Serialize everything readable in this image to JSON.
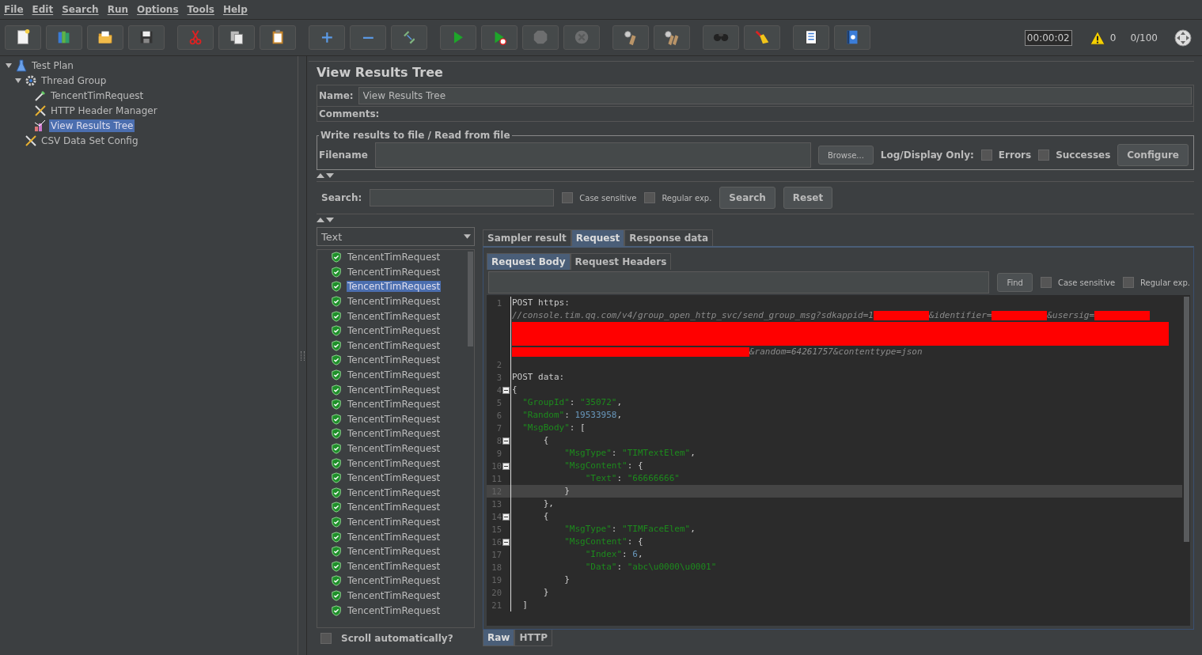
{
  "menu": [
    "File",
    "Edit",
    "Search",
    "Run",
    "Options",
    "Tools",
    "Help"
  ],
  "toolbar": [
    [
      {
        "kind": "new",
        "disabled": false
      },
      {
        "kind": "templates",
        "disabled": false
      },
      {
        "kind": "open",
        "disabled": false
      },
      {
        "kind": "save",
        "disabled": false
      }
    ],
    [
      {
        "kind": "cut",
        "disabled": false
      },
      {
        "kind": "copy",
        "disabled": false
      },
      {
        "kind": "paste",
        "disabled": false
      }
    ],
    [
      {
        "kind": "expand",
        "disabled": false
      },
      {
        "kind": "collapse",
        "disabled": false
      },
      {
        "kind": "toggle",
        "disabled": false
      }
    ],
    [
      {
        "kind": "start",
        "disabled": false
      },
      {
        "kind": "start_no_pause",
        "disabled": false
      },
      {
        "kind": "stop",
        "disabled": true
      },
      {
        "kind": "shutdown",
        "disabled": true
      }
    ],
    [
      {
        "kind": "clear",
        "disabled": false
      },
      {
        "kind": "clear_all",
        "disabled": false
      }
    ],
    [
      {
        "kind": "search",
        "disabled": false
      },
      {
        "kind": "reset_search",
        "disabled": false
      }
    ],
    [
      {
        "kind": "functions",
        "disabled": false
      },
      {
        "kind": "help",
        "disabled": false
      }
    ]
  ],
  "status": {
    "timer": "00:00:02",
    "warnings": "0",
    "threads": "0/100"
  },
  "tree": [
    {
      "label": "Test Plan",
      "kind": "plan",
      "expanded": true,
      "selected": false,
      "children": [
        {
          "label": "Thread Group",
          "kind": "threads",
          "expanded": true,
          "selected": false,
          "children": [
            {
              "label": "TencentTimRequest",
              "kind": "sampler",
              "selected": false
            },
            {
              "label": "HTTP Header Manager",
              "kind": "config",
              "selected": false
            },
            {
              "label": "View Results Tree",
              "kind": "listener",
              "selected": true
            }
          ]
        },
        {
          "label": "CSV Data Set Config",
          "kind": "config",
          "selected": false
        }
      ]
    }
  ],
  "panel": {
    "title": "View Results Tree",
    "name_label": "Name:",
    "name_value": "View Results Tree",
    "comments_label": "Comments:",
    "file_group": {
      "legend": "Write results to file / Read from file",
      "filename_label": "Filename",
      "browse": "Browse...",
      "log_label": "Log/Display Only:",
      "checks": [
        {
          "label": "Errors",
          "checked": false
        },
        {
          "label": "Successes",
          "checked": false
        }
      ],
      "configure": "Configure"
    },
    "search": {
      "label": "Search:",
      "options": [
        {
          "label": "Case sensitive",
          "checked": false
        },
        {
          "label": "Regular exp.",
          "checked": false
        }
      ],
      "buttons": [
        "Search",
        "Reset"
      ]
    },
    "renderer": "Text",
    "results": [
      {
        "label": "TencentTimRequest",
        "selected": false
      },
      {
        "label": "TencentTimRequest",
        "selected": false
      },
      {
        "label": "TencentTimRequest",
        "selected": true
      },
      {
        "label": "TencentTimRequest",
        "selected": false
      },
      {
        "label": "TencentTimRequest",
        "selected": false
      },
      {
        "label": "TencentTimRequest",
        "selected": false
      },
      {
        "label": "TencentTimRequest",
        "selected": false
      },
      {
        "label": "TencentTimRequest",
        "selected": false
      },
      {
        "label": "TencentTimRequest",
        "selected": false
      },
      {
        "label": "TencentTimRequest",
        "selected": false
      },
      {
        "label": "TencentTimRequest",
        "selected": false
      },
      {
        "label": "TencentTimRequest",
        "selected": false
      },
      {
        "label": "TencentTimRequest",
        "selected": false
      },
      {
        "label": "TencentTimRequest",
        "selected": false
      },
      {
        "label": "TencentTimRequest",
        "selected": false
      },
      {
        "label": "TencentTimRequest",
        "selected": false
      },
      {
        "label": "TencentTimRequest",
        "selected": false
      },
      {
        "label": "TencentTimRequest",
        "selected": false
      },
      {
        "label": "TencentTimRequest",
        "selected": false
      },
      {
        "label": "TencentTimRequest",
        "selected": false
      },
      {
        "label": "TencentTimRequest",
        "selected": false
      },
      {
        "label": "TencentTimRequest",
        "selected": false
      },
      {
        "label": "TencentTimRequest",
        "selected": false
      },
      {
        "label": "TencentTimRequest",
        "selected": false
      },
      {
        "label": "TencentTimRequest",
        "selected": false
      }
    ],
    "scroll_auto": {
      "label": "Scroll automatically?",
      "checked": false
    },
    "tabs": [
      {
        "label": "Sampler result",
        "selected": false
      },
      {
        "label": "Request",
        "selected": true
      },
      {
        "label": "Response data",
        "selected": false
      }
    ],
    "sub_tabs": [
      {
        "label": "Request Body",
        "selected": true
      },
      {
        "label": "Request Headers",
        "selected": false
      }
    ],
    "find": {
      "button": "Find",
      "options": [
        {
          "label": "Case sensitive",
          "checked": false
        },
        {
          "label": "Regular exp.",
          "checked": false
        }
      ]
    },
    "code_lines": [
      {
        "number": "1",
        "fold": false,
        "current": false,
        "tokens": [
          {
            "kind": "plain",
            "text": "POST https:"
          },
          {
            "kind": "break"
          },
          {
            "kind": "url",
            "text": "//console.tim.qq.com/v4/group_open_http_svc/send_group_msg?sdkappid=1"
          },
          {
            "kind": "redacted_short"
          },
          {
            "kind": "url",
            "text": "&identifier="
          },
          {
            "kind": "redacted_short"
          },
          {
            "kind": "url",
            "text": "&usersig="
          },
          {
            "kind": "redacted_short"
          },
          {
            "kind": "break"
          },
          {
            "kind": "redacted_full"
          },
          {
            "kind": "break"
          },
          {
            "kind": "redacted_long"
          },
          {
            "kind": "url",
            "text": "&random=64261757&contenttype=json"
          }
        ]
      },
      {
        "number": "2",
        "fold": false,
        "current": false
      },
      {
        "number": "3",
        "fold": false,
        "current": false,
        "tokens": [
          {
            "kind": "plain",
            "text": "POST data:"
          }
        ]
      },
      {
        "number": "4",
        "fold": true,
        "current": false,
        "tokens": [
          {
            "kind": "plain",
            "text": "{"
          }
        ]
      },
      {
        "number": "5",
        "fold": false,
        "current": false,
        "tokens": [
          {
            "kind": "key",
            "text": "  \"GroupId\""
          },
          {
            "kind": "plain",
            "text": ": "
          },
          {
            "kind": "string",
            "text": "\"35072\""
          },
          {
            "kind": "plain",
            "text": ","
          }
        ]
      },
      {
        "number": "6",
        "fold": false,
        "current": false,
        "tokens": [
          {
            "kind": "key",
            "text": "  \"Random\""
          },
          {
            "kind": "plain",
            "text": ": "
          },
          {
            "kind": "number",
            "text": "19533958"
          },
          {
            "kind": "plain",
            "text": ","
          }
        ]
      },
      {
        "number": "7",
        "fold": false,
        "current": false,
        "tokens": [
          {
            "kind": "key",
            "text": "  \"MsgBody\""
          },
          {
            "kind": "plain",
            "text": ": ["
          }
        ]
      },
      {
        "number": "8",
        "fold": true,
        "current": false,
        "tokens": [
          {
            "kind": "plain",
            "text": "      {"
          }
        ]
      },
      {
        "number": "9",
        "fold": false,
        "current": false,
        "tokens": [
          {
            "kind": "key",
            "text": "          \"MsgType\""
          },
          {
            "kind": "plain",
            "text": ": "
          },
          {
            "kind": "string",
            "text": "\"TIMTextElem\""
          },
          {
            "kind": "plain",
            "text": ","
          }
        ]
      },
      {
        "number": "10",
        "fold": true,
        "current": false,
        "tokens": [
          {
            "kind": "key",
            "text": "          \"MsgContent\""
          },
          {
            "kind": "plain",
            "text": ": {"
          }
        ]
      },
      {
        "number": "11",
        "fold": false,
        "current": false,
        "tokens": [
          {
            "kind": "key",
            "text": "              \"Text\""
          },
          {
            "kind": "plain",
            "text": ": "
          },
          {
            "kind": "string",
            "text": "\"66666666\""
          }
        ]
      },
      {
        "number": "12",
        "fold": false,
        "current": true,
        "tokens": [
          {
            "kind": "plain",
            "text": "          }"
          }
        ]
      },
      {
        "number": "13",
        "fold": false,
        "current": false,
        "tokens": [
          {
            "kind": "plain",
            "text": "      },"
          }
        ]
      },
      {
        "number": "14",
        "fold": true,
        "current": false,
        "tokens": [
          {
            "kind": "plain",
            "text": "      {"
          }
        ]
      },
      {
        "number": "15",
        "fold": false,
        "current": false,
        "tokens": [
          {
            "kind": "key",
            "text": "          \"MsgType\""
          },
          {
            "kind": "plain",
            "text": ": "
          },
          {
            "kind": "string",
            "text": "\"TIMFaceElem\""
          },
          {
            "kind": "plain",
            "text": ","
          }
        ]
      },
      {
        "number": "16",
        "fold": true,
        "current": false,
        "tokens": [
          {
            "kind": "key",
            "text": "          \"MsgContent\""
          },
          {
            "kind": "plain",
            "text": ": {"
          }
        ]
      },
      {
        "number": "17",
        "fold": false,
        "current": false,
        "tokens": [
          {
            "kind": "key",
            "text": "              \"Index\""
          },
          {
            "kind": "plain",
            "text": ": "
          },
          {
            "kind": "number",
            "text": "6"
          },
          {
            "kind": "plain",
            "text": ","
          }
        ]
      },
      {
        "number": "18",
        "fold": false,
        "current": false,
        "tokens": [
          {
            "kind": "key",
            "text": "              \"Data\""
          },
          {
            "kind": "plain",
            "text": ": "
          },
          {
            "kind": "string",
            "text": "\"abc\\u0000\\u0001\""
          }
        ]
      },
      {
        "number": "19",
        "fold": false,
        "current": false,
        "tokens": [
          {
            "kind": "plain",
            "text": "          }"
          }
        ]
      },
      {
        "number": "20",
        "fold": false,
        "current": false,
        "tokens": [
          {
            "kind": "plain",
            "text": "      }"
          }
        ]
      },
      {
        "number": "21",
        "fold": false,
        "current": false,
        "tokens": [
          {
            "kind": "plain",
            "text": "  ]"
          }
        ]
      }
    ],
    "bottom_tabs": [
      {
        "label": "Raw",
        "selected": true
      },
      {
        "label": "HTTP",
        "selected": false
      }
    ]
  }
}
